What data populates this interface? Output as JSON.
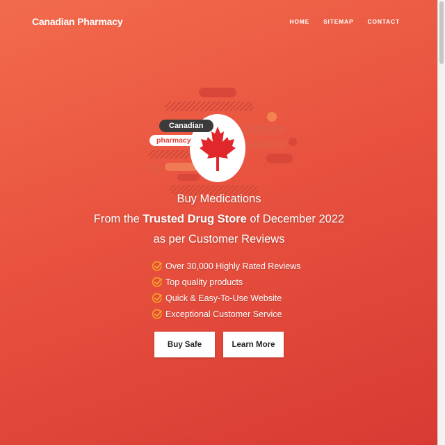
{
  "navbar": {
    "brand": "Canadian Pharmacy",
    "links": [
      "HOME",
      "SITEMAP",
      "CONTACT"
    ]
  },
  "logo": {
    "top_label": "Canadian",
    "bottom_label": "pharmacy",
    "icon": "maple-leaf-icon"
  },
  "hero": {
    "line1": "Buy Medications",
    "line2_prefix": "From the ",
    "line2_bold": "Trusted Drug Store",
    "line2_suffix": " of December 2022",
    "line3": "as per Customer Reviews"
  },
  "features": [
    "Over 30,000 Highly Rated Reviews",
    "Top quality products",
    "Quick & Easy-To-Use Website",
    "Exceptional Customer Service"
  ],
  "buttons": {
    "buy": "Buy Safe",
    "learn": "Learn More"
  },
  "colors": {
    "background_start": "#f26b4c",
    "background_end": "#d73a33",
    "check_icon": "#f5a623",
    "maple_red": "#e0272b"
  }
}
